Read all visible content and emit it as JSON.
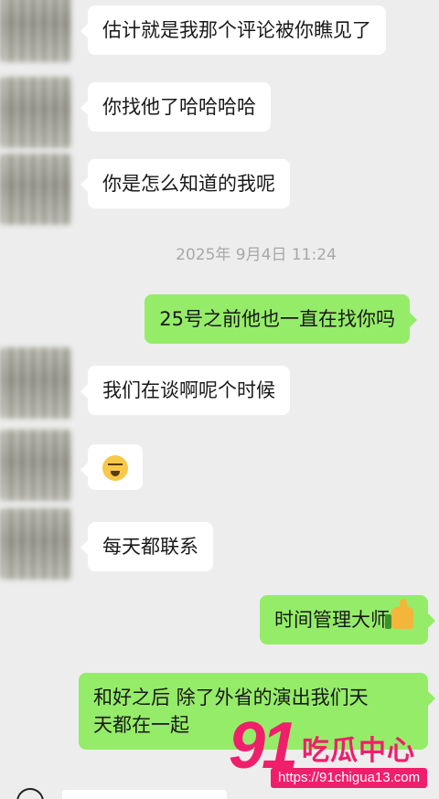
{
  "chat": {
    "timestamp": "2025年 9月4日 11:24",
    "messages": [
      {
        "side": "in",
        "text": "估计就是我那个评论被你瞧见了"
      },
      {
        "side": "in",
        "text": "你找他了哈哈哈哈"
      },
      {
        "side": "in",
        "text": "你是怎么知道的我呢"
      },
      {
        "side": "out",
        "text": "25号之前他也一直在找你吗"
      },
      {
        "side": "in",
        "text": "我们在谈啊呢个时候"
      },
      {
        "side": "in",
        "emoji": "grin-emoji"
      },
      {
        "side": "in",
        "text": "每天都联系"
      },
      {
        "side": "out",
        "text": "时间管理大师",
        "emoji": "thumbs-up-emoji"
      },
      {
        "side": "out",
        "line1": "和好之后 除了外省的演出我们天",
        "line2": "天都在一起"
      }
    ]
  },
  "watermark": {
    "number": "91",
    "title": "吃瓜中心",
    "url": "https://91chigua13.com"
  },
  "colors": {
    "background": "#ededed",
    "incoming_bubble": "#ffffff",
    "outgoing_bubble": "#95ec69",
    "timestamp_text": "#a8a8a8",
    "watermark": "#ef1f6c"
  }
}
